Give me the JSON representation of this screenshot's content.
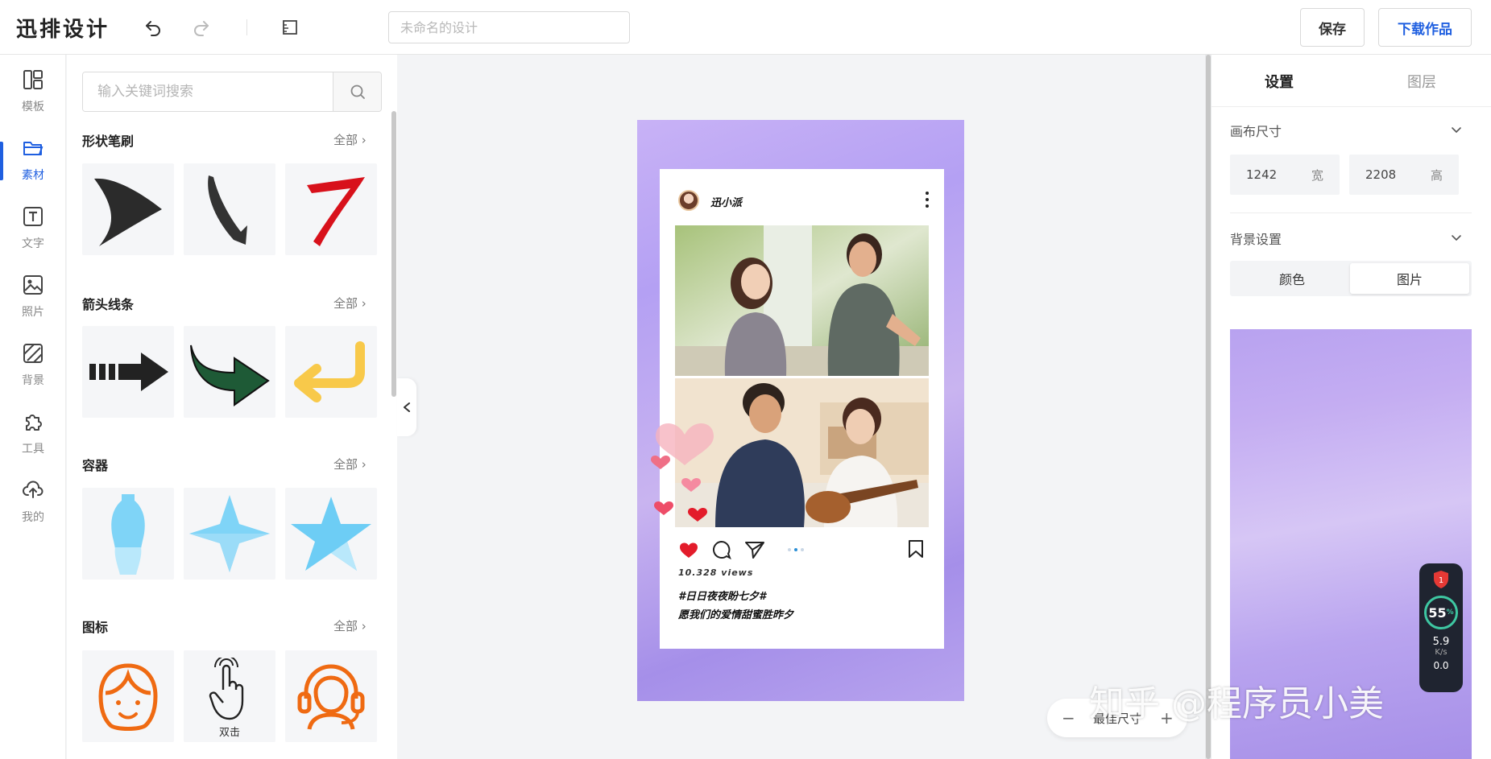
{
  "app": {
    "logo": "迅排设计"
  },
  "toolbar": {
    "title_placeholder": "未命名的设计",
    "title_value": "",
    "save_label": "保存",
    "download_label": "下载作品",
    "icons": [
      "undo-icon",
      "redo-icon",
      "ruler-icon"
    ]
  },
  "rail": {
    "items": [
      {
        "label": "模板",
        "icon": "template-icon"
      },
      {
        "label": "素材",
        "icon": "folder-icon",
        "active": true
      },
      {
        "label": "文字",
        "icon": "text-icon"
      },
      {
        "label": "照片",
        "icon": "image-icon"
      },
      {
        "label": "背景",
        "icon": "background-icon"
      },
      {
        "label": "工具",
        "icon": "puzzle-icon"
      },
      {
        "label": "我的",
        "icon": "cloud-upload-icon"
      }
    ]
  },
  "panel": {
    "search_placeholder": "输入关键词搜索",
    "sections": [
      {
        "title": "形状笔刷",
        "all": "全部",
        "tiles": [
          "brush-arrow",
          "brush-hook",
          "brush-red-7"
        ]
      },
      {
        "title": "箭头线条",
        "all": "全部",
        "tiles": [
          "dashed-arrow",
          "curved-arrow",
          "return-arrow"
        ]
      },
      {
        "title": "容器",
        "all": "全部",
        "tiles": [
          "vase-container",
          "four-point-star",
          "five-point-star"
        ]
      },
      {
        "title": "图标",
        "all": "全部",
        "tiles": [
          "woman-face-icon",
          "double-tap-icon",
          "support-headset-icon"
        ],
        "captions": [
          "",
          "双击",
          ""
        ]
      }
    ]
  },
  "canvas": {
    "post": {
      "username": "迅小派",
      "views": "10.328  views",
      "caption_line1": "#日日夜夜盼七夕#",
      "caption_line2": "愿我们的爱情甜蜜胜昨夕"
    },
    "zoom": {
      "minus": "−",
      "label": "最佳尺寸",
      "plus": "+"
    }
  },
  "right_panel": {
    "tabs": {
      "settings": "设置",
      "layers": "图层"
    },
    "canvas_size": {
      "title": "画布尺寸",
      "width": "1242",
      "width_unit": "宽",
      "height": "2208",
      "height_unit": "高"
    },
    "background": {
      "title": "背景设置",
      "color_label": "颜色",
      "image_label": "图片",
      "selected": "图片"
    }
  },
  "speed_widget": {
    "badge": "1",
    "percent": "55",
    "percent_unit": "%",
    "speed": "5.9",
    "speed_unit": "K/s",
    "down": "0.0"
  },
  "watermark": "知乎 @程序员小美",
  "colors": {
    "accent": "#1f5fe0",
    "artboard_purple": "#b4a0f3"
  }
}
